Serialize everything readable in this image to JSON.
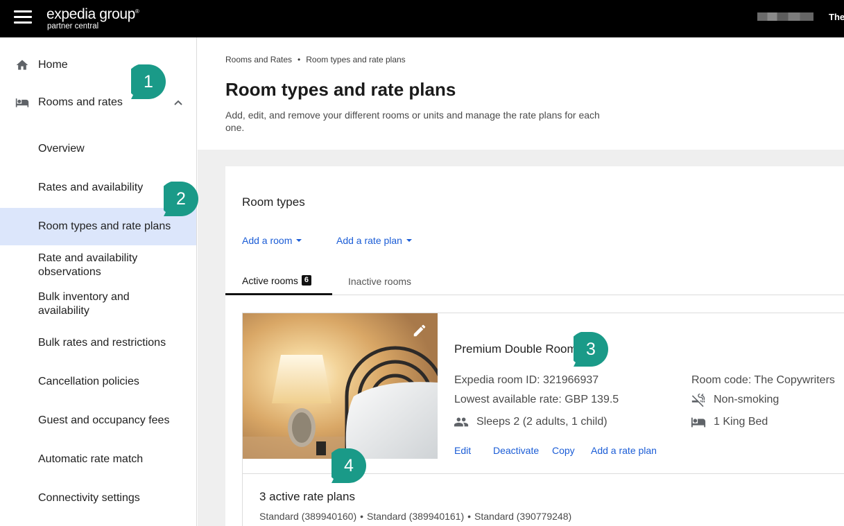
{
  "topbar": {
    "logo_main": "expedia group",
    "logo_mark": "®",
    "logo_sub": "partner central",
    "user_text": "The"
  },
  "sidebar": {
    "home_label": "Home",
    "rooms_label": "Rooms and rates",
    "items": [
      {
        "label": "Overview"
      },
      {
        "label": "Rates and availability"
      },
      {
        "label": "Room types and rate plans",
        "active": true
      },
      {
        "label": "Rate and availability observations"
      },
      {
        "label": "Bulk inventory and availability"
      },
      {
        "label": "Bulk rates and restrictions"
      },
      {
        "label": "Cancellation policies"
      },
      {
        "label": "Guest and occupancy fees"
      },
      {
        "label": "Automatic rate match"
      },
      {
        "label": "Connectivity settings"
      }
    ]
  },
  "breadcrumb": {
    "parent": "Rooms and Rates",
    "separator": "•",
    "current": "Room types and rate plans"
  },
  "page": {
    "title": "Room types and rate plans",
    "description": "Add, edit, and remove your different rooms or units and manage the rate plans for each one."
  },
  "card": {
    "title": "Room types",
    "add_room": "Add a room",
    "add_rate_plan": "Add a rate plan",
    "tabs": {
      "active_label": "Active rooms",
      "active_count": "6",
      "inactive_label": "Inactive rooms"
    }
  },
  "room": {
    "name": "Premium Double Room",
    "expedia_id": "Expedia room ID: 321966937",
    "lowest_rate": "Lowest available rate: GBP 139.5",
    "sleeps": "Sleeps 2 (2 adults, 1 child)",
    "room_code": "Room code: The Copywriters",
    "smoking": "Non-smoking",
    "bed": "1 King Bed",
    "actions": {
      "edit": "Edit",
      "deactivate": "Deactivate",
      "copy": "Copy",
      "add_rate_plan": "Add a rate plan"
    }
  },
  "rate_plans": {
    "title": "3 active rate plans",
    "separator": "•",
    "items": [
      "Standard (389940160)",
      "Standard (389940161)",
      "Standard (390779248)"
    ]
  },
  "callouts": [
    "1",
    "2",
    "3",
    "4"
  ],
  "colors": {
    "link": "#1a5cd6",
    "active_nav_bg": "#dce6fb",
    "callout": "#1a9a88",
    "topbar": "#000000"
  }
}
